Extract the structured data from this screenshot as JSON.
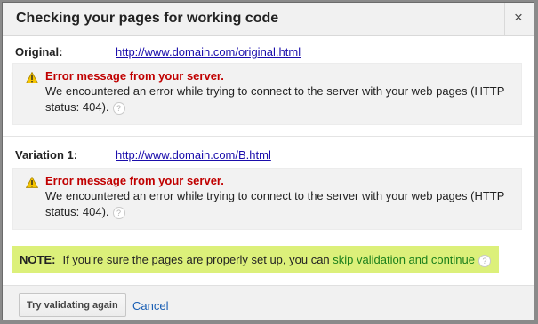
{
  "dialog": {
    "title": "Checking your pages for working code",
    "close_label": "×"
  },
  "sections": [
    {
      "label": "Original:",
      "url": "http://www.domain.com/original.html",
      "error_title": "Error message from your server.",
      "error_body": "We encountered an error while trying to connect to the server with your web pages (HTTP status: 404)."
    },
    {
      "label": "Variation 1:",
      "url": "http://www.domain.com/B.html",
      "error_title": "Error message from your server.",
      "error_body": "We encountered an error while trying to connect to the server with your web pages (HTTP status: 404)."
    }
  ],
  "note": {
    "label": "NOTE:",
    "text": "If you're sure the pages are properly set up, you can",
    "link": "skip validation and continue"
  },
  "footer": {
    "retry_label": "Try validating again",
    "cancel_label": "Cancel"
  },
  "colors": {
    "error": "#c00000",
    "note_bg": "#dcf07a",
    "note_link": "#1b7f1b",
    "link": "#1a0dab"
  }
}
